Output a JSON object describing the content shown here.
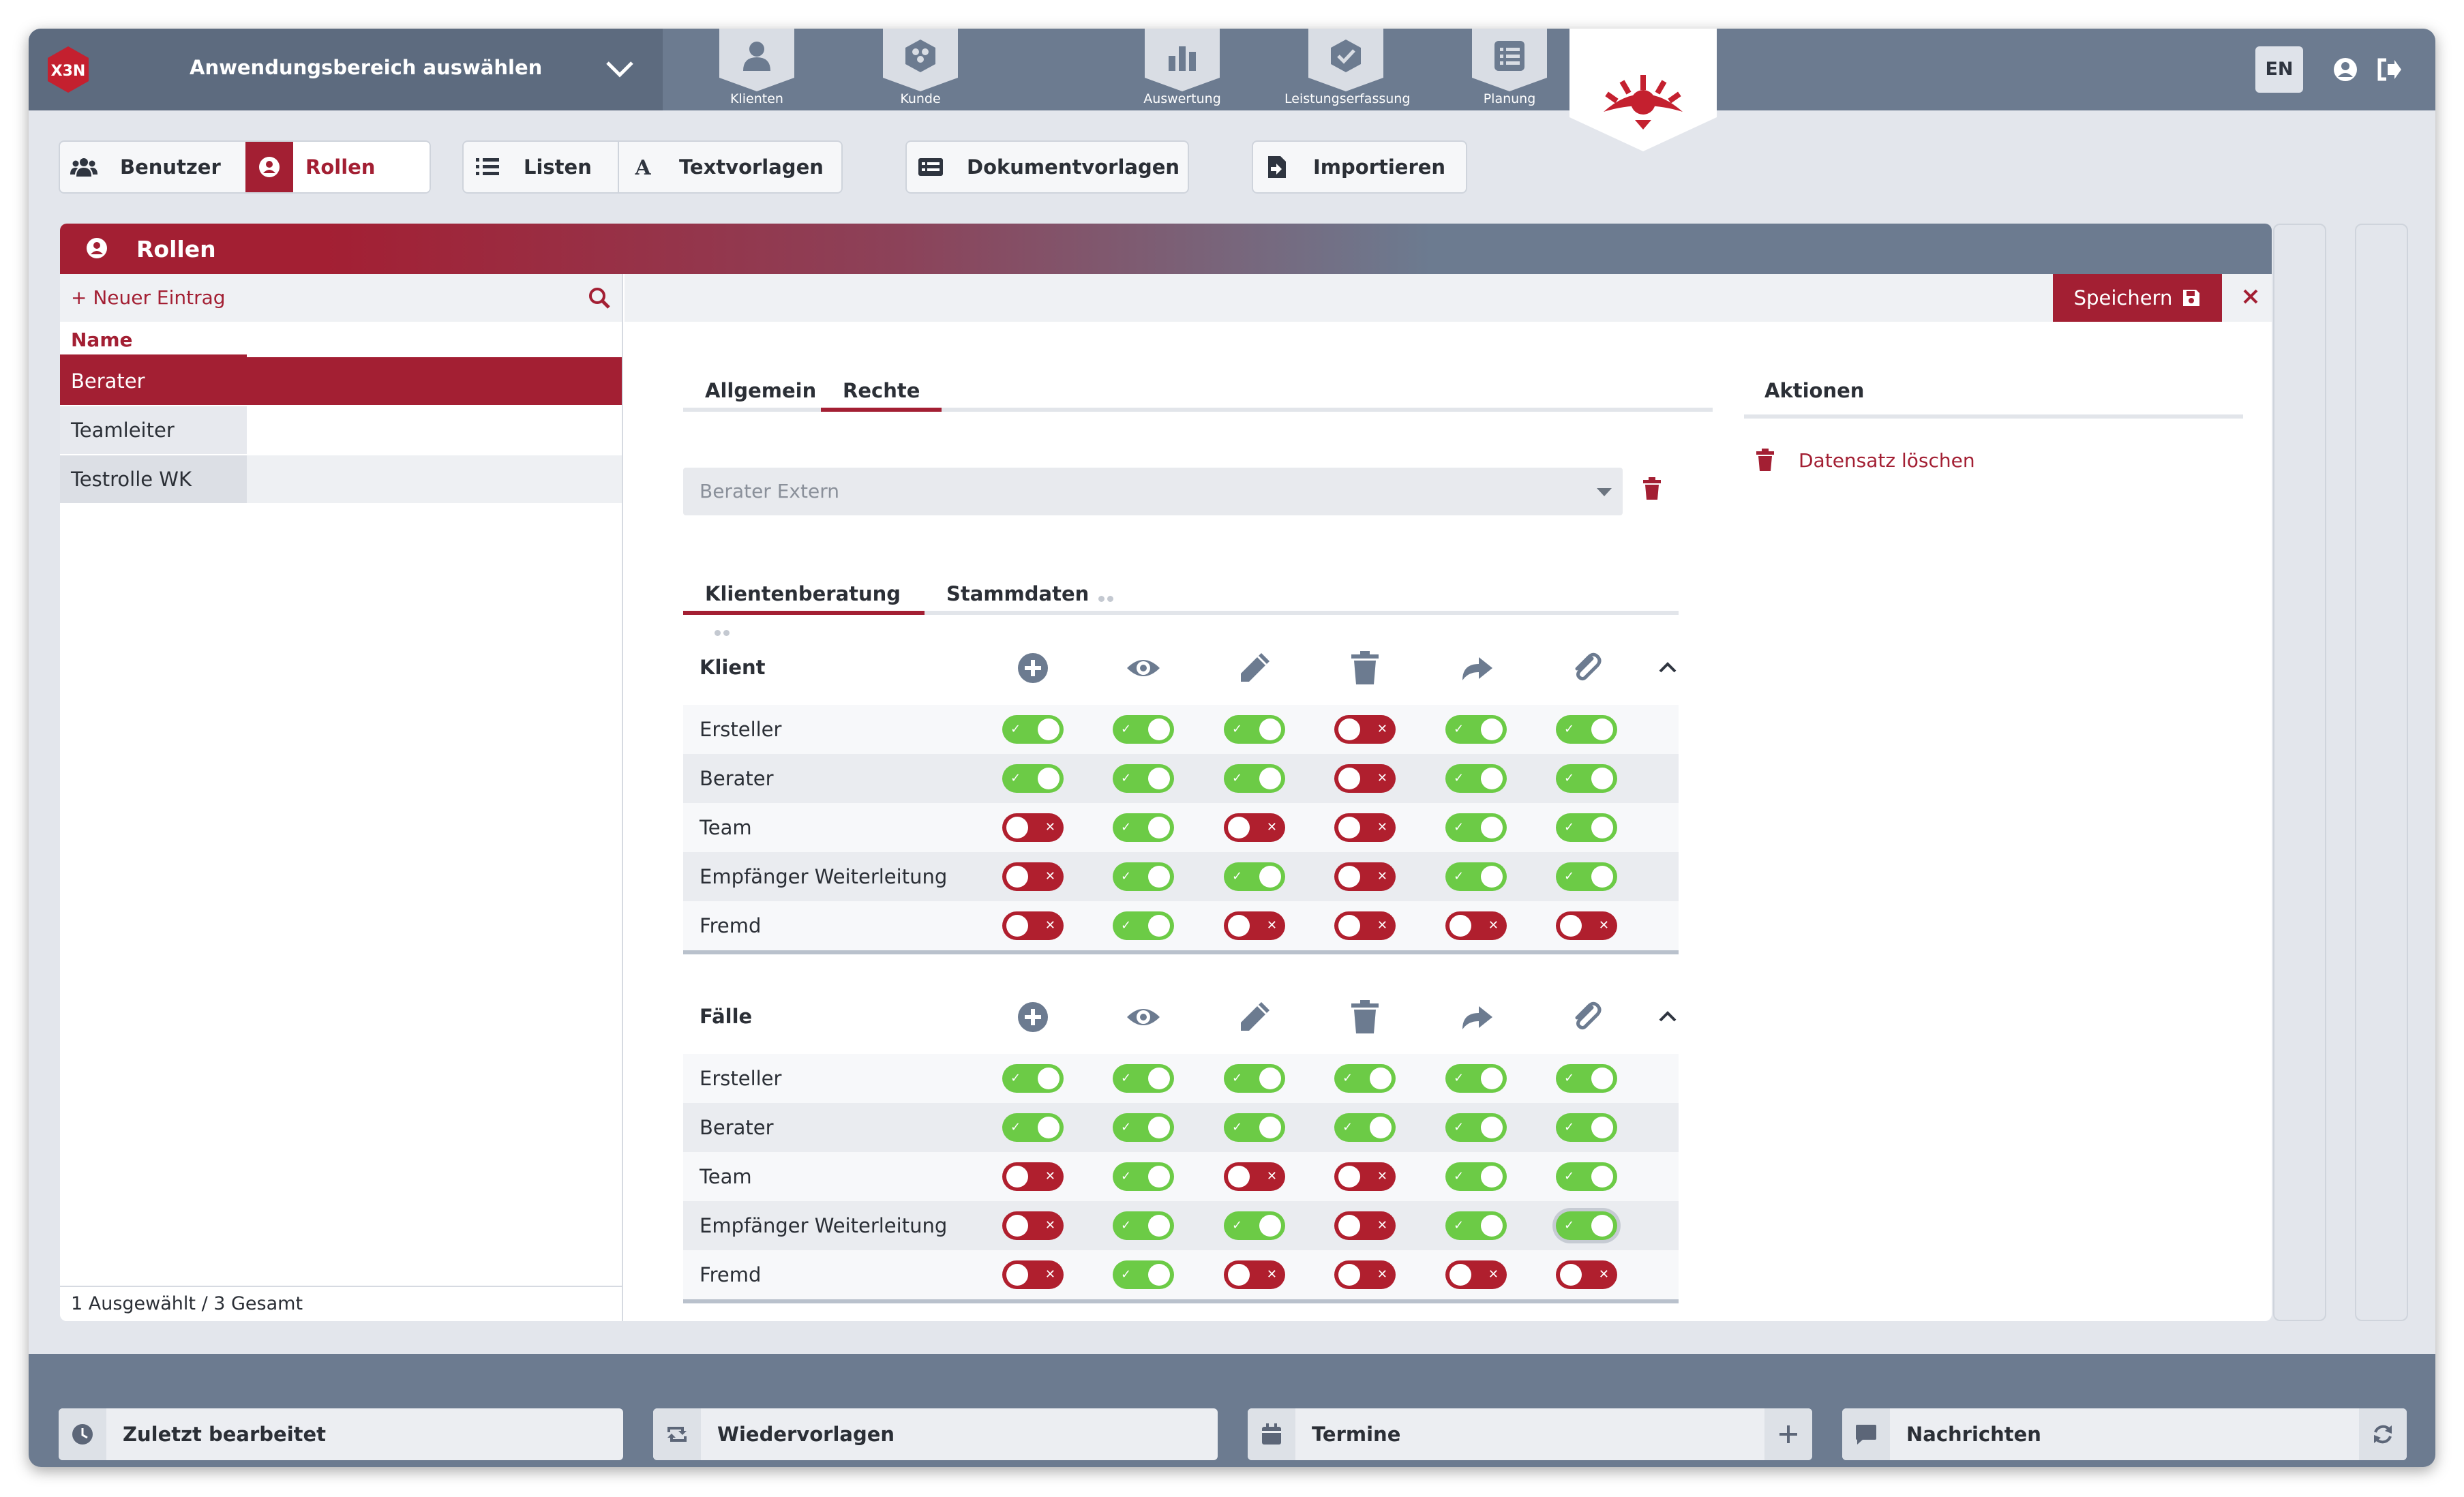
{
  "colors": {
    "brand": "#a31f33",
    "topbar": "#6c7b90",
    "toggle_on": "#6ccb46",
    "toggle_off": "#b01f2e"
  },
  "logo": {
    "text": "X3N"
  },
  "header": {
    "app_selector": "Anwendungsbereich auswählen",
    "nav_tabs": [
      {
        "label": "Klienten",
        "icon": "person-icon"
      },
      {
        "label": "Kunde",
        "icon": "group-icon"
      },
      {
        "label": "Auswertung",
        "icon": "bar-chart-icon"
      },
      {
        "label": "Leistungserfassung",
        "icon": "check-badge-icon"
      },
      {
        "label": "Planung",
        "icon": "list-icon"
      }
    ],
    "language": "EN"
  },
  "module_tabs": {
    "users": "Benutzer",
    "roles": "Rollen",
    "lists": "Listen",
    "text_templates": "Textvorlagen",
    "document_templates": "Dokumentvorlagen",
    "import": "Importieren"
  },
  "panel": {
    "title": "Rollen",
    "new_entry": "+ Neuer Eintrag",
    "column_name": "Name",
    "rows": [
      "Berater",
      "Teamleiter",
      "Testrolle WK"
    ],
    "selected_index": 0,
    "footer": "1 Ausgewählt / 3 Gesamt",
    "save": "Speichern"
  },
  "detail": {
    "tabs": [
      "Allgemein",
      "Rechte"
    ],
    "active_tab": "Rechte",
    "role_select_value": "Berater Extern",
    "subtabs": [
      "Klientenberatung",
      "Stammdaten"
    ],
    "actions_title": "Aktionen",
    "delete_record": "Datensatz löschen"
  },
  "permission_columns": [
    "add-icon",
    "view-icon",
    "edit-icon",
    "delete-icon",
    "forward-icon",
    "attach-icon"
  ],
  "permissions": [
    {
      "title": "Klient",
      "rows": [
        {
          "label": "Ersteller",
          "values": [
            true,
            true,
            true,
            false,
            true,
            true
          ]
        },
        {
          "label": "Berater",
          "values": [
            true,
            true,
            true,
            false,
            true,
            true
          ]
        },
        {
          "label": "Team",
          "values": [
            false,
            true,
            false,
            false,
            true,
            true
          ]
        },
        {
          "label": "Empfänger Weiterleitung",
          "values": [
            false,
            true,
            true,
            false,
            true,
            true
          ]
        },
        {
          "label": "Fremd",
          "values": [
            false,
            true,
            false,
            false,
            false,
            false
          ]
        }
      ]
    },
    {
      "title": "Fälle",
      "rows": [
        {
          "label": "Ersteller",
          "values": [
            true,
            true,
            true,
            true,
            true,
            true
          ]
        },
        {
          "label": "Berater",
          "values": [
            true,
            true,
            true,
            true,
            true,
            true
          ]
        },
        {
          "label": "Team",
          "values": [
            false,
            true,
            false,
            false,
            true,
            true
          ]
        },
        {
          "label": "Empfänger Weiterleitung",
          "values": [
            false,
            true,
            true,
            false,
            true,
            true
          ]
        },
        {
          "label": "Fremd",
          "values": [
            false,
            true,
            false,
            false,
            false,
            false
          ]
        }
      ]
    }
  ],
  "bottom_panels": {
    "recent": "Zuletzt bearbeitet",
    "resubmissions": "Wiedervorlagen",
    "appointments": "Termine",
    "messages": "Nachrichten"
  }
}
